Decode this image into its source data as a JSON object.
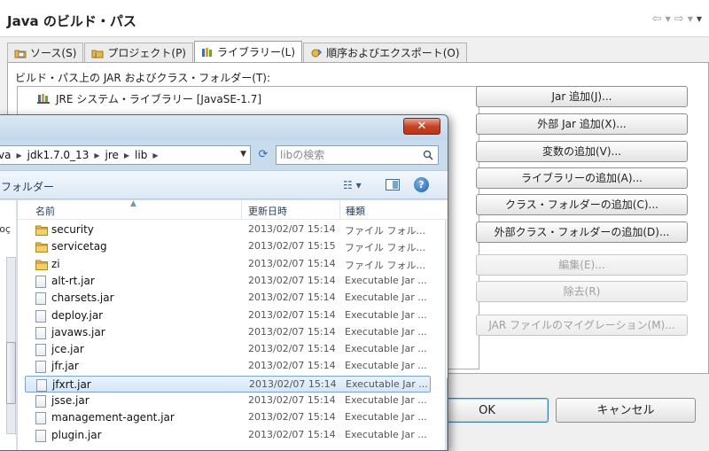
{
  "page": {
    "title": "Java のビルド・パス",
    "tabs": [
      {
        "label": "ソース(S)",
        "icon": "source-folder-icon"
      },
      {
        "label": "プロジェクト(P)",
        "icon": "project-icon"
      },
      {
        "label": "ライブラリー(L)",
        "icon": "library-icon",
        "active": true
      },
      {
        "label": "順序およびエクスポート(O)",
        "icon": "order-export-icon"
      }
    ],
    "list_label": "ビルド・パス上の JAR およびクラス・フォルダー(T):",
    "libraries": [
      "JRE システム・ライブラリー [JavaSE-1.7]"
    ],
    "buttons": [
      {
        "label": "Jar 追加(J)...",
        "enabled": true
      },
      {
        "label": "外部 Jar 追加(X)...",
        "enabled": true
      },
      {
        "label": "変数の追加(V)...",
        "enabled": true
      },
      {
        "label": "ライブラリーの追加(A)...",
        "enabled": true
      },
      {
        "label": "クラス・フォルダーの追加(C)...",
        "enabled": true
      },
      {
        "label": "外部クラス・フォルダーの追加(D)...",
        "enabled": true
      },
      {
        "label": "編集(E)...",
        "enabled": false
      },
      {
        "label": "除去(R)",
        "enabled": false
      },
      {
        "label": "JAR ファイルのマイグレーション(M)...",
        "enabled": false
      }
    ],
    "ok_label": "OK",
    "cancel_label": "キャンセル"
  },
  "dialog": {
    "breadcrumb": [
      "va",
      "jdk1.7.0_13",
      "jre",
      "lib"
    ],
    "search_placeholder": "libの検索",
    "new_folder_label": "フォルダー",
    "nav_label": "roç",
    "columns": {
      "name": "名前",
      "date": "更新日時",
      "type": "種類"
    },
    "files": [
      {
        "name": "security",
        "date": "2013/02/07 15:14",
        "type": "ファイル フォル...",
        "kind": "folder"
      },
      {
        "name": "servicetag",
        "date": "2013/02/07 15:15",
        "type": "ファイル フォル...",
        "kind": "folder"
      },
      {
        "name": "zi",
        "date": "2013/02/07 15:14",
        "type": "ファイル フォル...",
        "kind": "folder"
      },
      {
        "name": "alt-rt.jar",
        "date": "2013/02/07 15:14",
        "type": "Executable Jar ...",
        "kind": "jar"
      },
      {
        "name": "charsets.jar",
        "date": "2013/02/07 15:14",
        "type": "Executable Jar ...",
        "kind": "jar"
      },
      {
        "name": "deploy.jar",
        "date": "2013/02/07 15:14",
        "type": "Executable Jar ...",
        "kind": "jar"
      },
      {
        "name": "javaws.jar",
        "date": "2013/02/07 15:14",
        "type": "Executable Jar ...",
        "kind": "jar"
      },
      {
        "name": "jce.jar",
        "date": "2013/02/07 15:14",
        "type": "Executable Jar ...",
        "kind": "jar"
      },
      {
        "name": "jfr.jar",
        "date": "2013/02/07 15:14",
        "type": "Executable Jar ...",
        "kind": "jar"
      },
      {
        "name": "jfxrt.jar",
        "date": "2013/02/07 15:14",
        "type": "Executable Jar ...",
        "kind": "jar",
        "selected": true
      },
      {
        "name": "jsse.jar",
        "date": "2013/02/07 15:14",
        "type": "Executable Jar ...",
        "kind": "jar"
      },
      {
        "name": "management-agent.jar",
        "date": "2013/02/07 15:14",
        "type": "Executable Jar ...",
        "kind": "jar"
      },
      {
        "name": "plugin.jar",
        "date": "2013/02/07 15:14",
        "type": "Executable Jar ...",
        "kind": "jar"
      }
    ]
  },
  "colors": {
    "accent": "#3c7fb1",
    "folder": "#e8b84a",
    "selection": "#d4e6f9",
    "close": "#c7432a"
  }
}
